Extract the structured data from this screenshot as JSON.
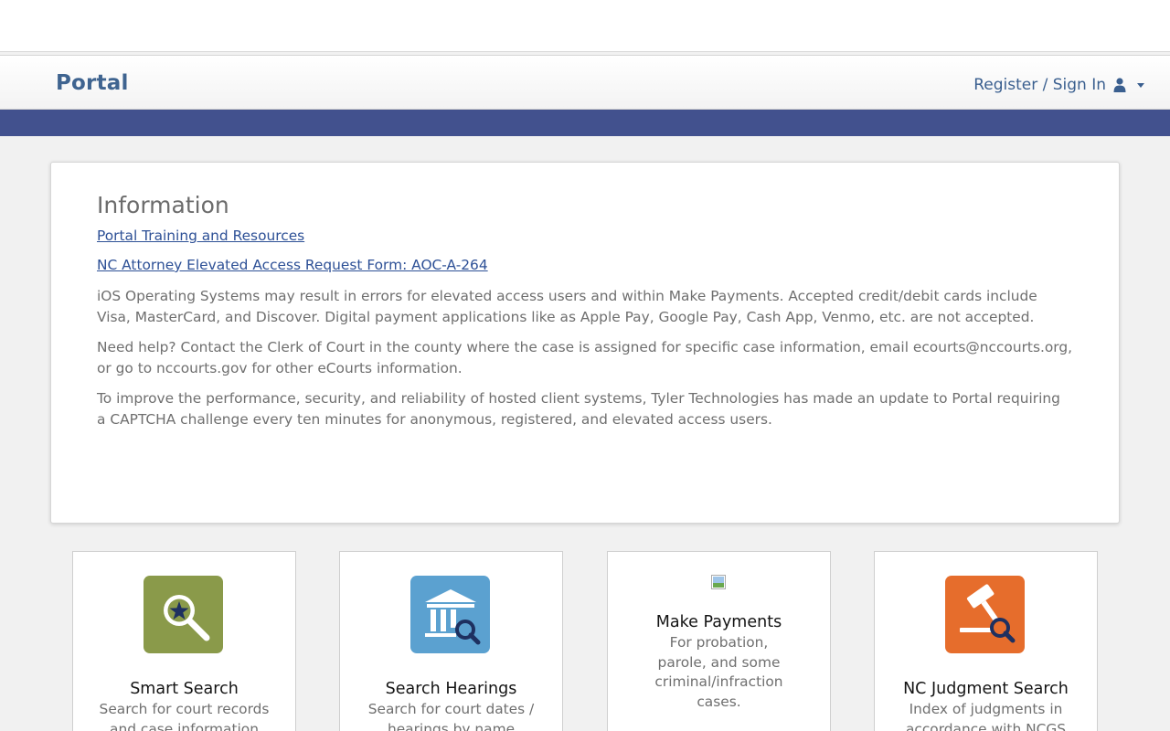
{
  "header": {
    "brand": "Portal",
    "signin_label": "Register / Sign In"
  },
  "info": {
    "title": "Information",
    "links": [
      "Portal Training and Resources",
      "NC Attorney Elevated Access Request Form: AOC-A-264"
    ],
    "paragraphs": [
      "iOS Operating Systems may result in errors for elevated access users and within Make Payments. Accepted credit/debit cards include Visa, MasterCard, and Discover. Digital payment applications like as Apple Pay, Google Pay, Cash App, Venmo, etc. are not accepted.",
      "Need help? Contact the Clerk of Court in the county where the case is assigned for specific case information, email ecourts@nccourts.org, or go to nccourts.gov for other eCourts information.",
      "To improve the performance, security, and reliability of hosted client systems, Tyler Technologies has made an update to Portal requiring a CAPTCHA challenge every ten minutes for anonymous, registered, and elevated access users."
    ]
  },
  "tiles": [
    {
      "title": "Smart Search",
      "desc": "Search for court records and case information",
      "icon": "magnifier-star-icon",
      "color": "#8a9a4a"
    },
    {
      "title": "Search Hearings",
      "desc": "Search for court dates / hearings by name",
      "icon": "courthouse-search-icon",
      "color": "#5ba1d0"
    },
    {
      "title": "Make Payments",
      "desc": "For probation, parole, and some criminal/infraction cases.",
      "icon": "broken-image-icon",
      "color": ""
    },
    {
      "title": "NC Judgment Search",
      "desc": "Index of judgments in accordance with NCGS",
      "icon": "gavel-search-icon",
      "color": "#e66d2c"
    }
  ],
  "colors": {
    "banner": "#42518e",
    "brand": "#3f6490",
    "link": "#2d5096"
  }
}
